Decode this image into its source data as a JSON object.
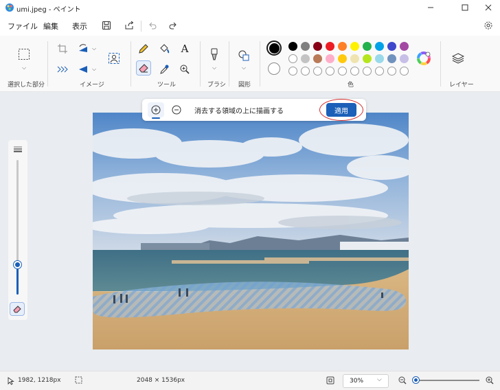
{
  "window": {
    "title": "umi.jpeg - ペイント"
  },
  "menu": {
    "file": "ファイル",
    "edit": "編集",
    "view": "表示"
  },
  "ribbon": {
    "groups": {
      "selection": "選択した部分",
      "image": "イメージ",
      "tools": "ツール",
      "brush": "ブラシ",
      "shapes": "図形",
      "colors": "色",
      "layers": "レイヤー"
    },
    "text_tool_glyph": "A",
    "colors_row1": [
      "#000000",
      "#7f7f7f",
      "#880015",
      "#ed1c24",
      "#ff7f27",
      "#fff200",
      "#22b14c",
      "#00a2e8",
      "#3f48cc",
      "#a349a4"
    ],
    "colors_row2": [
      "#ffffff",
      "#c3c3c3",
      "#b97a57",
      "#ffaec9",
      "#ffc90e",
      "#efe4b0",
      "#b5e61d",
      "#99d9ea",
      "#7092be",
      "#c8bfe7"
    ],
    "primary_color": "#000000",
    "secondary_color": "#ffffff",
    "empty_slots": 10
  },
  "eraser_toolbar": {
    "instruction": "消去する領域の上に描画する",
    "apply_label": "適用"
  },
  "brush_size": {
    "level": 0.22
  },
  "status": {
    "cursor_position": "1982, 1218px",
    "image_size": "2048 × 1536px",
    "zoom": "30%",
    "zoom_level": 0.05
  },
  "accent_color": "#1b5fb8"
}
